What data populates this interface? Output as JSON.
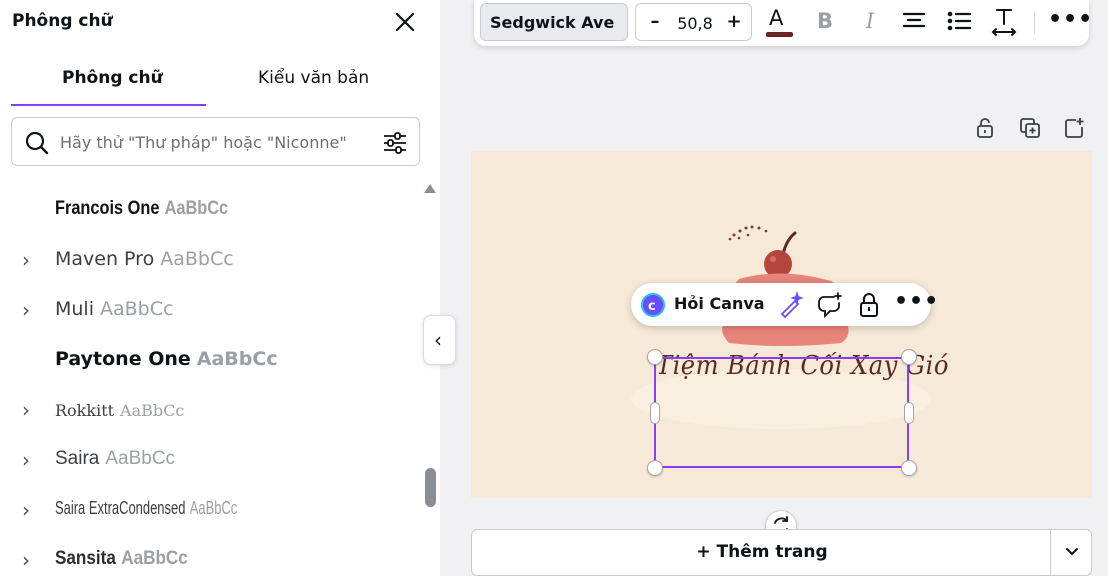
{
  "panel": {
    "title": "Phông chữ",
    "tabs": [
      {
        "label": "Phông chữ",
        "active": true
      },
      {
        "label": "Kiểu văn bản",
        "active": false
      }
    ],
    "search_placeholder": "Hãy thử \"Thư pháp\" hoặc \"Niconne\"",
    "fonts": [
      {
        "name": "Francois One",
        "sample": "AaBbCc",
        "expandable": false
      },
      {
        "name": "Maven Pro",
        "sample": "AaBbCc",
        "expandable": true
      },
      {
        "name": "Muli",
        "sample": "AaBbCc",
        "expandable": true
      },
      {
        "name": "Paytone One",
        "sample": "AaBbCc",
        "expandable": false
      },
      {
        "name": "Rokkitt",
        "sample": "AaBbCc",
        "expandable": true
      },
      {
        "name": "Saira",
        "sample": "AaBbCc",
        "expandable": true
      },
      {
        "name": "Saira ExtraCondensed",
        "sample": "AaBbCc",
        "expandable": true
      },
      {
        "name": "Sansita",
        "sample": "AaBbCc",
        "expandable": true
      }
    ]
  },
  "toolbar": {
    "font_family": "Sedgwick Ave",
    "font_size": "50,8",
    "minus": "–",
    "plus": "+",
    "text_color": "#6b2423",
    "color_letter": "A",
    "bold": "B",
    "italic": "I",
    "more": "•••"
  },
  "canvas": {
    "title_text": "Tiệm Bánh Cối Xay Gió",
    "background": "#f6e9d7",
    "selection_color": "#8b3dff"
  },
  "context_menu": {
    "ask_label": "Hỏi Canva",
    "more": "•••"
  },
  "bottom": {
    "add_page_label": "+ Thêm trang"
  },
  "colors": {
    "accent": "#8b3dff",
    "logo_pink": "#e8857a",
    "cherry": "#b5453a",
    "stem": "#5a2a22"
  }
}
